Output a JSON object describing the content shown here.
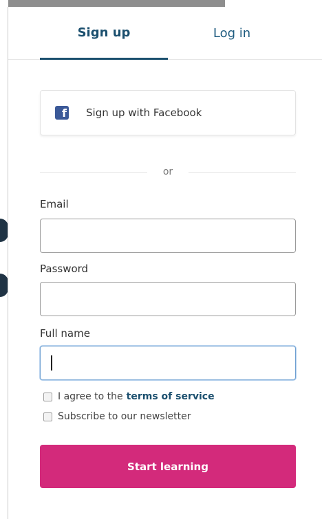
{
  "tabs": {
    "signup_label": "Sign up",
    "login_label": "Log in",
    "active": "signup"
  },
  "facebook": {
    "icon": "facebook-icon",
    "label": "Sign up with Facebook",
    "icon_glyph": "f"
  },
  "divider": {
    "text": "or"
  },
  "form": {
    "email": {
      "label": "Email",
      "value": "",
      "placeholder": ""
    },
    "password": {
      "label": "Password",
      "value": "",
      "placeholder": ""
    },
    "full_name": {
      "label": "Full name",
      "value": "",
      "placeholder": "",
      "focused": true
    }
  },
  "checkboxes": {
    "terms": {
      "prefix": "I agree to the",
      "link": "terms of service",
      "checked": false
    },
    "newsletter": {
      "label": "Subscribe to our newsletter",
      "checked": false
    }
  },
  "submit": {
    "label": "Start learning"
  },
  "colors": {
    "brand_blue": "#1b4f6e",
    "facebook_blue": "#3b5998",
    "cta_pink": "#d32a7b"
  }
}
